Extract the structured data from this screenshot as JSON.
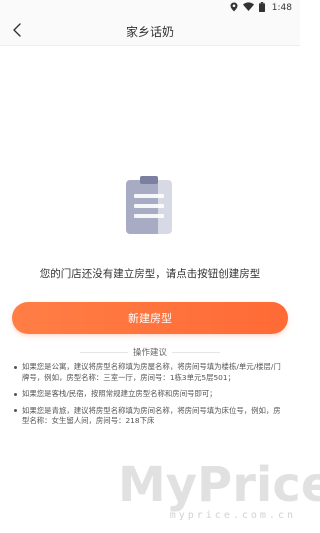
{
  "status_bar": {
    "time": "1:48",
    "icons": [
      "location-icon",
      "wifi-icon",
      "battery-icon"
    ]
  },
  "header": {
    "title": "家乡话奶",
    "back_icon": "chevron-left-icon"
  },
  "empty_state": {
    "icon": "clipboard-icon",
    "message": "您的门店还没有建立房型，请点击按钮创建房型"
  },
  "create_button": {
    "label": "新建房型"
  },
  "suggestions": {
    "title": "操作建议",
    "items": [
      "如果您是公寓，建议将房型名称填为房屋名称，将房间号填为楼栋/单元/楼层/门牌号，例如，房型名称：三室一厅，房间号：1栋3单元5层501；",
      "如果您是客栈/民宿，按照常规建立房型名称和房间号即可；",
      "如果您是青旅，建议将房型名称填为房间名称，将房间号填为床位号，例如，房型名称：女生留人间，房间号：218下床"
    ]
  },
  "watermark": {
    "brand": "MyPrice",
    "domain": "myprice.com.cn"
  },
  "colors": {
    "accent": "#ff6a35",
    "header_bg": "#fafafa",
    "icon_fill": "#a7abc4"
  }
}
